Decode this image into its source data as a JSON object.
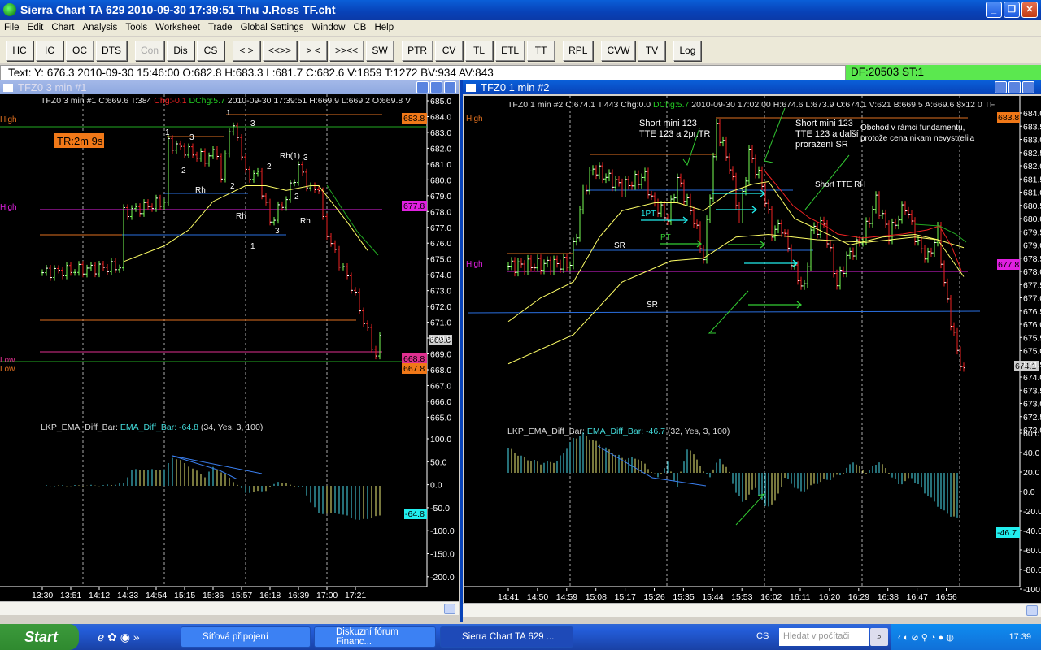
{
  "app": {
    "title": "Sierra Chart TA 629  2010-09-30  17:39:51  Thu   J.Ross TF.cht"
  },
  "menu": [
    "File",
    "Edit",
    "Chart",
    "Analysis",
    "Tools",
    "Worksheet",
    "Trade",
    "Global Settings",
    "Window",
    "CB",
    "Help"
  ],
  "toolbar": [
    [
      "HC",
      "IC",
      "OC",
      "DTS"
    ],
    [
      "Con",
      "Dis",
      "CS"
    ],
    [
      "< >",
      "<<>>",
      "> <",
      ">><<",
      "SW"
    ],
    [
      "PTR",
      "CV",
      "TL",
      "ETL",
      "TT"
    ],
    [
      "RPL"
    ],
    [
      "CVW",
      "TV"
    ],
    [
      "Log"
    ]
  ],
  "toolbar_disabled": "Con",
  "infoline": "Text: Y: 676.3  2010-09-30  15:46:00  O:682.8  H:683.3  L:681.7  C:682.6  V:1859  T:1272  BV:934  AV:843",
  "status": "DF:20503  ST:1",
  "left": {
    "window_title": "TFZ0  3 min   #1",
    "header": {
      "a": "TFZ0  3 min   #1 C:669.6 T:384 ",
      "chg": "Chg:-0.1",
      "dchg": " DChg:5.7",
      "b": " 2010-09-30 17:39:51 H:669.9 L:669.2 O:669.8 V"
    },
    "price_ticks": [
      "685.0",
      "684.0",
      "683.0",
      "682.0",
      "681.0",
      "680.0",
      "679.0",
      "678.0",
      "677.0",
      "676.0",
      "675.0",
      "674.0",
      "673.0",
      "672.0",
      "671.0",
      "670.0",
      "669.0",
      "668.0",
      "667.0",
      "666.0",
      "665.0"
    ],
    "osc_ticks": [
      "100.0",
      "50.0",
      "0.0",
      "-50.0",
      "-100.0",
      "-150.0",
      "-200.0"
    ],
    "time_ticks": [
      "13:30",
      "13:51",
      "14:12",
      "14:33",
      "14:54",
      "15:15",
      "15:36",
      "15:57",
      "16:18",
      "16:39",
      "17:00",
      "17:21"
    ],
    "labels": {
      "high1": "High",
      "high2": "High",
      "low1": "Low",
      "low2": "Low",
      "timer": "TR:2m 9s"
    },
    "tags": {
      "t1": "683.8",
      "t2": "677.8",
      "t3": "669.6",
      "t4": "668.8",
      "t5": "667.8",
      "osc": "-64.8"
    },
    "waves": [
      "1",
      "3",
      "2",
      "Rh",
      "1",
      "3",
      "2",
      "Rh",
      "2",
      "Rh(1)",
      "3",
      "2",
      "Rh",
      "3",
      "1"
    ],
    "osc_header": {
      "name": "LKP_EMA_Diff_Bar: ",
      "study": "EMA_Diff_Bar: -64.8",
      "params": "  (34, Yes, 3, 100)"
    },
    "price_keys": [
      [
        0,
        673.8
      ],
      [
        19,
        674.2
      ],
      [
        20,
        677.6
      ],
      [
        30,
        678.3
      ],
      [
        31,
        682
      ],
      [
        40,
        681
      ],
      [
        43,
        681.5
      ],
      [
        44,
        679.5
      ],
      [
        46,
        683
      ],
      [
        48,
        682.5
      ],
      [
        50,
        680
      ],
      [
        53,
        680
      ],
      [
        56,
        677
      ],
      [
        60,
        678.5
      ],
      [
        63,
        680.5
      ],
      [
        66,
        679
      ],
      [
        68,
        679.2
      ],
      [
        69,
        677
      ],
      [
        72,
        675
      ],
      [
        76,
        673
      ],
      [
        80,
        670
      ],
      [
        82,
        668.5
      ],
      [
        83,
        669.6
      ]
    ],
    "osc_keys": [
      [
        0,
        0
      ],
      [
        15,
        1
      ],
      [
        20,
        5
      ],
      [
        22,
        35
      ],
      [
        30,
        35
      ],
      [
        32,
        62
      ],
      [
        34,
        55
      ],
      [
        40,
        20
      ],
      [
        42,
        40
      ],
      [
        45,
        25
      ],
      [
        48,
        2
      ],
      [
        50,
        -15
      ],
      [
        55,
        -10
      ],
      [
        58,
        10
      ],
      [
        62,
        0
      ],
      [
        64,
        -5
      ],
      [
        66,
        -35
      ],
      [
        68,
        -60
      ],
      [
        73,
        -60
      ],
      [
        78,
        -75
      ],
      [
        83,
        -65
      ]
    ],
    "ema_keys": [
      [
        20,
        674.5
      ],
      [
        30,
        675.5
      ],
      [
        36,
        676.5
      ],
      [
        42,
        678.3
      ],
      [
        50,
        679.3
      ],
      [
        55,
        679.3
      ],
      [
        60,
        679.0
      ],
      [
        66,
        679.3
      ],
      [
        68,
        679.3
      ],
      [
        75,
        677.0
      ],
      [
        80,
        675.2
      ]
    ]
  },
  "right": {
    "window_title": "TFZ0  1 min   #2",
    "header": {
      "a": "TFZ0  1 min   #2 C:674.1 T:443 Chg:0.0 ",
      "dchg": "DChg:5.7",
      "b": " 2010-09-30 17:02:00 H:674.6 L:673.9 O:674.1 V:621 B:669.5 A:669.6 8x12 0 TF"
    },
    "price_ticks": [
      "684.0",
      "683.5",
      "683.0",
      "682.5",
      "682.0",
      "681.5",
      "681.0",
      "680.5",
      "680.0",
      "679.5",
      "679.0",
      "678.5",
      "678.0",
      "677.5",
      "677.0",
      "676.5",
      "676.0",
      "675.5",
      "675.0",
      "674.5",
      "674.0",
      "673.5",
      "673.0",
      "672.5",
      "672.0"
    ],
    "osc_ticks": [
      "60.0",
      "40.0",
      "20.0",
      "0.0",
      "-20.0",
      "-40.0",
      "-60.0",
      "-80.0",
      "-100.0"
    ],
    "time_ticks": [
      "14:41",
      "14:50",
      "14:59",
      "15:08",
      "15:17",
      "15:26",
      "15:35",
      "15:44",
      "15:53",
      "16:02",
      "16:11",
      "16:20",
      "16:29",
      "16:38",
      "16:47",
      "16:56"
    ],
    "labels": {
      "high1": "High",
      "high2": "High",
      "sr1": "SR",
      "sr2": "SR",
      "pt1": "1PT",
      "pt2": "PT"
    },
    "notes": {
      "n1": [
        "Short mini 123",
        "TTE 123 a 2pr.TR"
      ],
      "n2": [
        "Short mini 123",
        "TTE 123 a další",
        "proražení SR"
      ],
      "n3": [
        "Obchod v rámci fundamentu,",
        "protože cena nikam nevystrelila"
      ],
      "n4": "Short TTE RH"
    },
    "tags": {
      "t1": "683.8",
      "t2": "677.8",
      "t3": "674.1",
      "osc": "-46.7"
    },
    "osc_header": {
      "name": "LKP_EMA_Diff_Bar: ",
      "study": "EMA_Diff_Bar: -46.7",
      "params": "  (32, Yes, 3, 100)"
    },
    "price_keys": [
      [
        0,
        678.2
      ],
      [
        19,
        678.3
      ],
      [
        21,
        679.5
      ],
      [
        23,
        681
      ],
      [
        26,
        681.9
      ],
      [
        35,
        681.2
      ],
      [
        42,
        681.6
      ],
      [
        44,
        680.7
      ],
      [
        49,
        680
      ],
      [
        52,
        681.5
      ],
      [
        57,
        680
      ],
      [
        60,
        678.5
      ],
      [
        62,
        681
      ],
      [
        64,
        683.5
      ],
      [
        68,
        682
      ],
      [
        71,
        680
      ],
      [
        74,
        682.5
      ],
      [
        78,
        681.3
      ],
      [
        81,
        679.5
      ],
      [
        84,
        679.7
      ],
      [
        88,
        678
      ],
      [
        91,
        677.3
      ],
      [
        93,
        679.5
      ],
      [
        97,
        679.8
      ],
      [
        101,
        677.5
      ],
      [
        104,
        678.5
      ],
      [
        109,
        679.3
      ],
      [
        113,
        680.7
      ],
      [
        117,
        679.4
      ],
      [
        122,
        680.5
      ],
      [
        126,
        679
      ],
      [
        129,
        678.5
      ],
      [
        132,
        679.5
      ],
      [
        134,
        677.5
      ],
      [
        137,
        675.5
      ],
      [
        140,
        674.1
      ]
    ],
    "osc_keys": [
      [
        0,
        25
      ],
      [
        5,
        15
      ],
      [
        10,
        10
      ],
      [
        15,
        12
      ],
      [
        20,
        35
      ],
      [
        23,
        40
      ],
      [
        30,
        25
      ],
      [
        35,
        15
      ],
      [
        40,
        15
      ],
      [
        43,
        5
      ],
      [
        46,
        -5
      ],
      [
        49,
        10
      ],
      [
        52,
        -15
      ],
      [
        53,
        0
      ],
      [
        55,
        25
      ],
      [
        58,
        15
      ],
      [
        60,
        0
      ],
      [
        62,
        -3
      ],
      [
        65,
        15
      ],
      [
        68,
        0
      ],
      [
        70,
        -20
      ],
      [
        72,
        -30
      ],
      [
        76,
        -15
      ],
      [
        79,
        -35
      ],
      [
        82,
        -30
      ],
      [
        85,
        -5
      ],
      [
        90,
        -20
      ],
      [
        95,
        -10
      ],
      [
        100,
        -5
      ],
      [
        103,
        0
      ],
      [
        106,
        12
      ],
      [
        110,
        0
      ],
      [
        114,
        12
      ],
      [
        117,
        0
      ],
      [
        120,
        -12
      ],
      [
        124,
        -5
      ],
      [
        128,
        -20
      ],
      [
        134,
        -40
      ],
      [
        138,
        -47
      ]
    ],
    "ema_fast_keys": [
      [
        0,
        676.1
      ],
      [
        10,
        677.0
      ],
      [
        20,
        677.6
      ],
      [
        28,
        679.3
      ],
      [
        35,
        680.3
      ],
      [
        45,
        680.6
      ],
      [
        52,
        680.6
      ],
      [
        60,
        680.3
      ],
      [
        68,
        681.0
      ],
      [
        75,
        681.3
      ],
      [
        80,
        681.4
      ],
      [
        88,
        680.0
      ],
      [
        95,
        679.6
      ],
      [
        105,
        679.0
      ],
      [
        115,
        679.3
      ],
      [
        125,
        679.4
      ],
      [
        132,
        679.2
      ],
      [
        140,
        677.8
      ]
    ],
    "ema_slow_keys": [
      [
        0,
        674.5
      ],
      [
        20,
        675.6
      ],
      [
        35,
        677.6
      ],
      [
        50,
        678.4
      ],
      [
        60,
        678.5
      ],
      [
        70,
        679.3
      ],
      [
        80,
        679.4
      ],
      [
        95,
        679.2
      ],
      [
        110,
        679.1
      ],
      [
        125,
        679.3
      ],
      [
        132,
        679.2
      ],
      [
        140,
        678.9
      ]
    ]
  },
  "taskbar": {
    "start": "Start",
    "tasks": [
      "Síťová připojení",
      "Diskuzní fórum Financ...",
      "Sierra Chart TA 629  ..."
    ],
    "lang": "CS",
    "search_placeholder": "Hledat v počítači",
    "clock": "17:39"
  }
}
